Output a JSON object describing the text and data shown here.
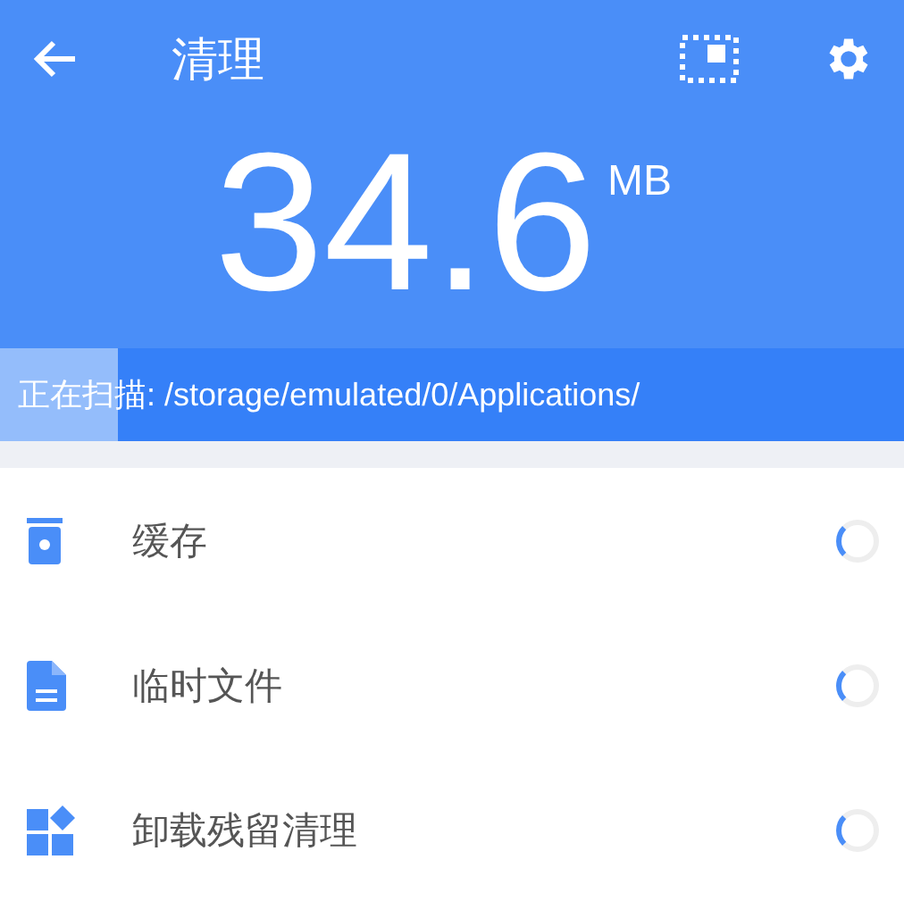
{
  "toolbar": {
    "title": "清理"
  },
  "total": {
    "value": "34.6",
    "unit": "MB"
  },
  "scan": {
    "text": "正在扫描: /storage/emulated/0/Applications/",
    "level": 0.13
  },
  "categories": [
    {
      "kind": "trash",
      "label": "缓存"
    },
    {
      "kind": "file",
      "label": "临时文件"
    },
    {
      "kind": "apps",
      "label": "卸载残留清理"
    }
  ]
}
